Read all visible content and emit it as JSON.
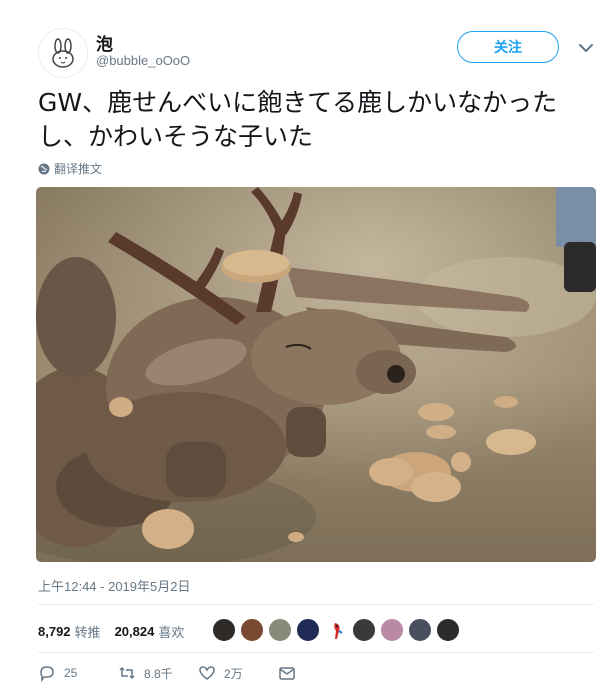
{
  "user": {
    "display_name": "泡",
    "handle": "@bubble_oOoO",
    "avatar_icon": "bunny-avatar"
  },
  "follow_label": "关注",
  "tweet": {
    "text": "GW、鹿せんべいに飽きてる鹿しかいなかったし、かわいそうな子いた",
    "translate_label": "翻译推文",
    "image_description_icon": "photo-deer-with-crackers",
    "timestamp": "上午12:44 - 2019年5月2日"
  },
  "stats": {
    "retweets_count": "8,792",
    "retweets_label": "转推",
    "likes_count": "20,824",
    "likes_label": "喜欢"
  },
  "actions": {
    "reply_count": "25",
    "retweet_count": "8.8千",
    "like_count": "2万"
  },
  "colors": {
    "accent": "#1da1f2",
    "text": "#14171a",
    "muted": "#657786",
    "divider": "#e6ecf0"
  },
  "liker_avatars": [
    "dark",
    "brown",
    "gray",
    "navy-flag",
    "parrot",
    "dark-gray",
    "pink",
    "portrait",
    "black-white"
  ]
}
